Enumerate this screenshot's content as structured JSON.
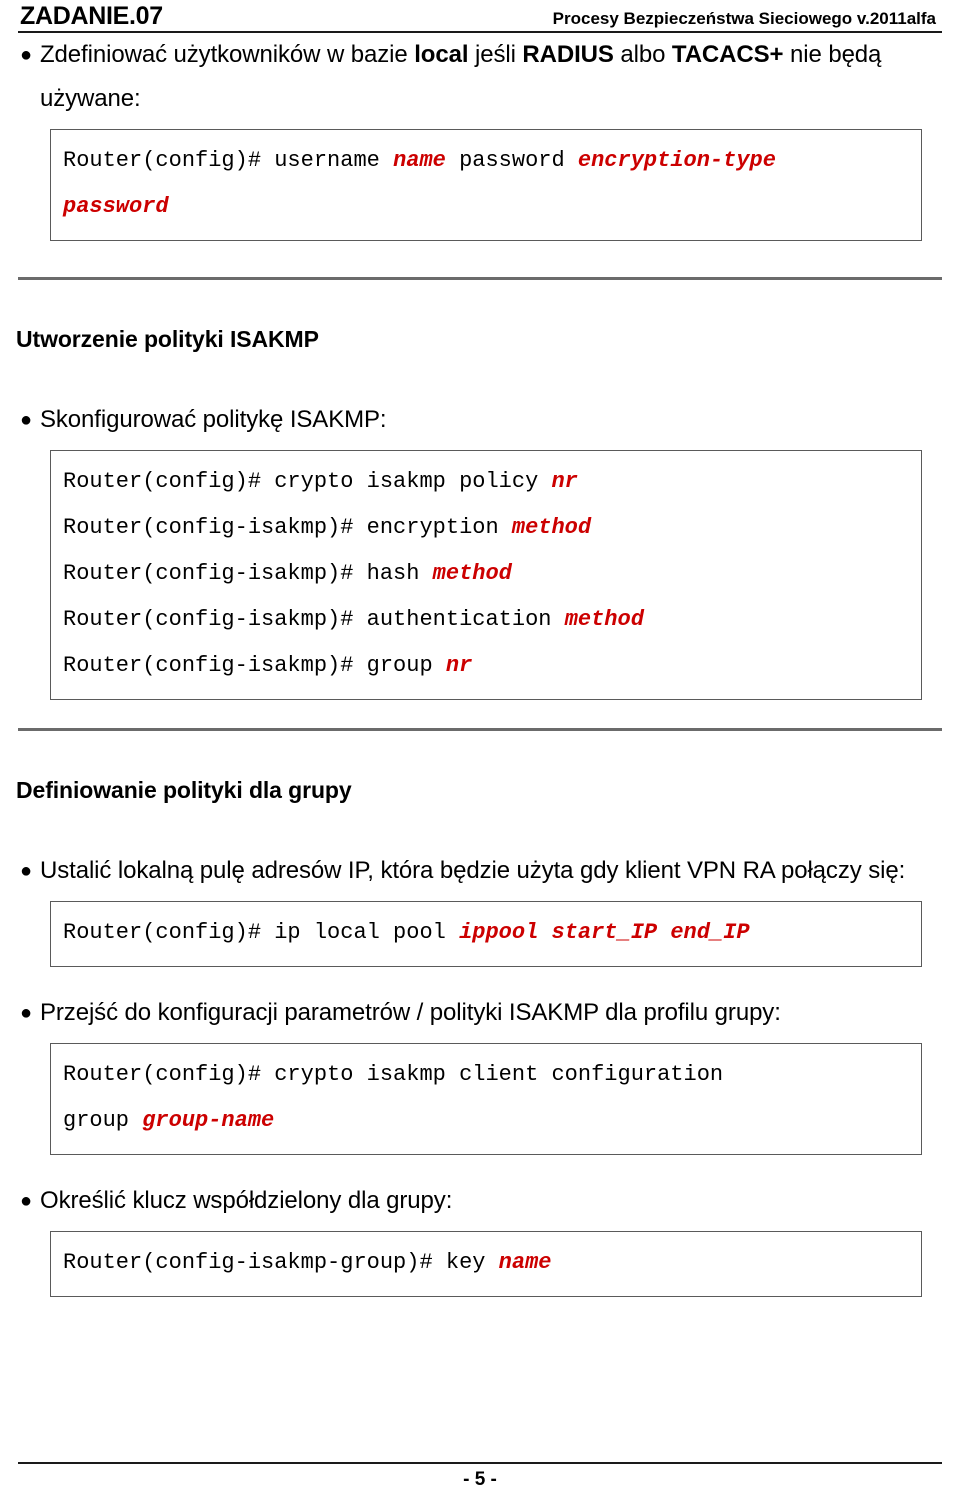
{
  "document": {
    "header": {
      "task_title": "ZADANIE.07",
      "course_title": "Procesy Bezpieczeństwa Sieciowego  v.2011alfa"
    },
    "footer": {
      "page_number": "- 5 -"
    },
    "bullet_glyph": "●",
    "colors": {
      "text": "#000000",
      "placeholder": "#cc0000",
      "rule": "#1a1a1a",
      "separator": "#6b6b6b",
      "code_border": "#5a5a5a"
    },
    "blocks": {
      "bullet_local_users": {
        "text_part_1": "Zdefiniować użytkowników w bazie ",
        "bold_1": "local",
        "text_part_2": " jeśli ",
        "bold_2": "RADIUS",
        "text_part_3": " albo ",
        "bold_3": "TACACS+",
        "text_part_4": " nie będą używane:"
      },
      "code_username": {
        "line_1_prefix": "Router(config)# username ",
        "line_1_var_1": "name",
        "line_1_mid": " password ",
        "line_1_var_2": "encryption-type",
        "line_2_var": "password"
      },
      "heading_isakmp": "Utworzenie polityki ISAKMP",
      "bullet_isakmp": "Skonfigurować politykę ISAKMP:",
      "code_isakmp": {
        "l1_cmd": "Router(config)# crypto isakmp policy ",
        "l1_var": "nr",
        "l2_cmd": "Router(config-isakmp)# encryption ",
        "l2_var": "method",
        "l3_cmd": "Router(config-isakmp)# hash ",
        "l3_var": "method",
        "l4_cmd": "Router(config-isakmp)# authentication ",
        "l4_var": "method",
        "l5_cmd": "Router(config-isakmp)# group ",
        "l5_var": "nr"
      },
      "heading_group_policy": "Definiowanie polityki dla grupy",
      "bullet_pool": "Ustalić  lokalną pulę adresów IP, która będzie użyta gdy klient VPN RA połączy się:",
      "code_pool": {
        "cmd": "Router(config)# ip local pool ",
        "var_1": "ippool",
        "var_2": " start_IP end_IP"
      },
      "bullet_group_profile": "Przejść do konfiguracji parametrów / polityki ISAKMP dla profilu grupy:",
      "code_group": {
        "line_1": "Router(config)# crypto isakmp client configuration",
        "line_2_cmd": "group ",
        "line_2_var": "group-name"
      },
      "bullet_shared_key": "Określić klucz współdzielony dla grupy:",
      "code_key": {
        "cmd": "Router(config-isakmp-group)# key ",
        "var": "name"
      }
    }
  }
}
